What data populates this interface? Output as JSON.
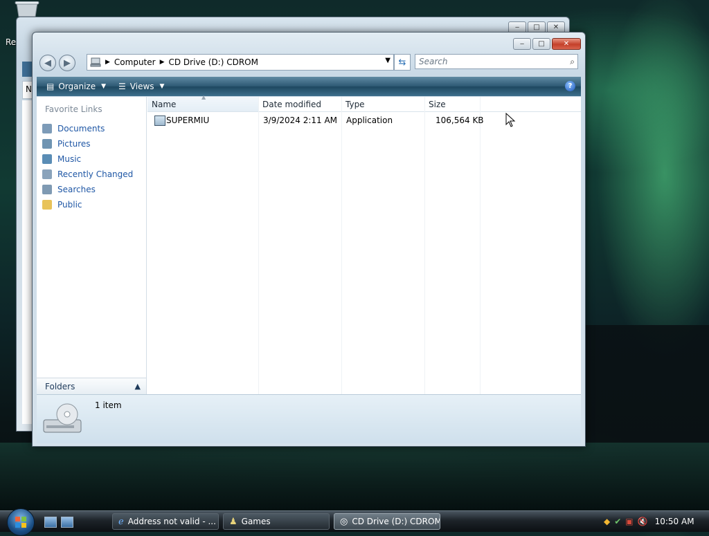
{
  "desktop": {
    "recycle_bin_label": "Re"
  },
  "background_window": {
    "column_stub": "N"
  },
  "window": {
    "address": {
      "crumbs": [
        "Computer",
        "CD Drive (D:) CDROM"
      ]
    },
    "search_placeholder": "Search",
    "toolbar": {
      "organize": "Organize",
      "views": "Views"
    },
    "nav": {
      "header": "Favorite Links",
      "items": [
        "Documents",
        "Pictures",
        "Music",
        "Recently Changed",
        "Searches",
        "Public"
      ],
      "folders_label": "Folders"
    },
    "columns": [
      "Name",
      "Date modified",
      "Type",
      "Size"
    ],
    "files": [
      {
        "name": "SUPERMIU",
        "date_modified": "3/9/2024 2:11 AM",
        "type": "Application",
        "size": "106,564 KB"
      }
    ],
    "details": {
      "count": "1 item"
    }
  },
  "taskbar": {
    "tasks": [
      "Address not valid - ...",
      "Games",
      "CD Drive (D:) CDROM"
    ],
    "clock": "10:50 AM"
  },
  "colors": {
    "link_blue": "#1f57a5",
    "toolbar_dark": "#1e4860"
  }
}
